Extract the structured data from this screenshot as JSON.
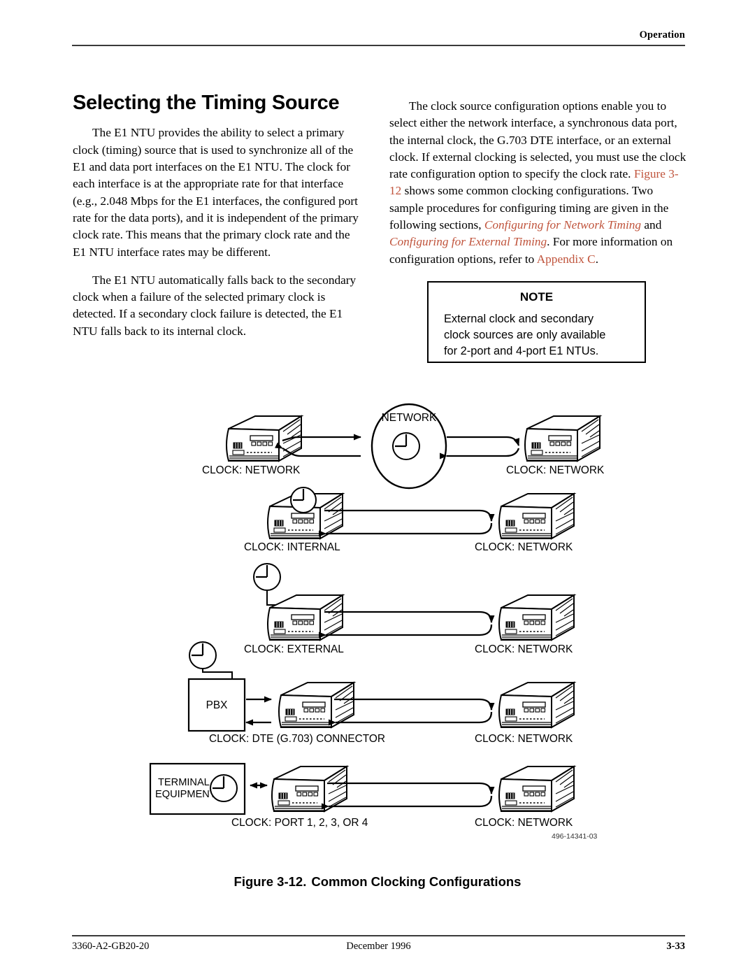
{
  "header": {
    "running_head": "Operation"
  },
  "left_column": {
    "section_title": "Selecting the Timing Source",
    "paragraph_1": "The E1 NTU provides the ability to select a primary clock (timing) source that is used to synchronize all of the E1 and data port interfaces on the E1 NTU. The clock for each interface is at the appropriate rate for that interface (e.g., 2.048 Mbps for the E1 interfaces, the configured port rate for the data ports), and it is independent of the primary clock rate. This means that the primary clock rate and the E1 NTU interface rates may be different.",
    "paragraph_2": "The E1 NTU automatically falls back to the secondary clock when a failure of the selected primary clock is detected. If a secondary clock failure is detected, the E1 NTU falls back to its internal clock."
  },
  "right_column": {
    "paragraph_1_part_1": "The clock source configuration options enable you to select either the network interface, a synchronous data port, the internal clock, the G.703 DTE interface, or an external clock. If external clocking is selected, you must use the clock rate configuration option to specify the clock rate. ",
    "xref_figure": "Figure 3-12",
    "paragraph_1_part_2": " shows some common clocking configurations. Two sample procedures for configuring timing are given in the following sections, ",
    "xref_config_network": "Configuring for Network Timing",
    "paragraph_1_part_3": " and ",
    "xref_config_external": "Configuring for External Timing",
    "paragraph_1_part_4": ". For more information on configuration options, refer to ",
    "xref_appendix": "Appendix C",
    "paragraph_1_part_5": "."
  },
  "note_box": {
    "title": "NOTE",
    "line_1": "External clock and secondary",
    "line_2": "clock sources are only available",
    "line_3": "for 2-port and 4-port E1 NTUs."
  },
  "figure": {
    "caption_number": "Figure 3-12.",
    "caption_text": "Common Clocking Configurations",
    "drawing_id": "496-14341-03",
    "network_cloud_label": "NETWORK",
    "pbx_label": "PBX",
    "terminal_equipment_line_1": "TERMINAL",
    "terminal_equipment_line_2": "EQUIPMENT",
    "rows": [
      {
        "name": "network-to-network",
        "left_label": "CLOCK: NETWORK",
        "right_label": "CLOCK: NETWORK"
      },
      {
        "name": "internal-to-network",
        "left_label": "CLOCK: INTERNAL",
        "right_label": "CLOCK: NETWORK"
      },
      {
        "name": "external-to-network",
        "left_label": "CLOCK: EXTERNAL",
        "right_label": "CLOCK: NETWORK"
      },
      {
        "name": "dte-g703-to-network",
        "left_label": "CLOCK: DTE (G.703) CONNECTOR",
        "right_label": "CLOCK: NETWORK"
      },
      {
        "name": "port-to-network",
        "left_label": "CLOCK: PORT 1, 2, 3, OR 4",
        "right_label": "CLOCK: NETWORK"
      }
    ]
  },
  "footer": {
    "document_number": "3360-A2-GB20-20",
    "date": "December 1996",
    "page_number": "3-33"
  }
}
